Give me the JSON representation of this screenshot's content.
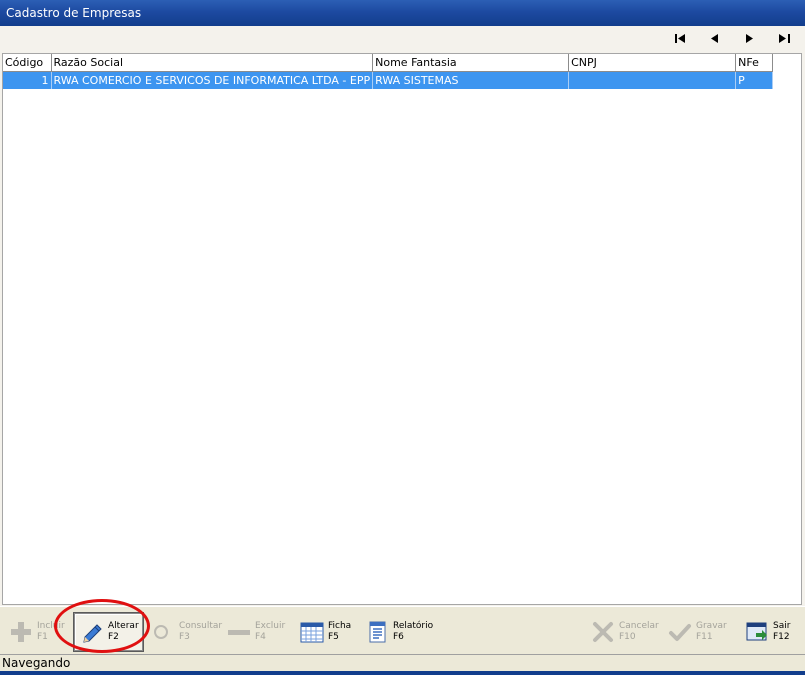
{
  "window": {
    "title": "Cadastro de Empresas"
  },
  "navigation": {
    "first_icon": "skip-first-icon",
    "prev_icon": "triangle-left-icon",
    "next_icon": "triangle-right-icon",
    "last_icon": "skip-last-icon"
  },
  "grid": {
    "columns": [
      "Código",
      "Razão Social",
      "Nome Fantasia",
      "CNPJ",
      "NFe"
    ],
    "rows": [
      {
        "codigo": "1",
        "razao_social": "RWA COMERCIO E SERVICOS DE INFORMATICA LTDA - EPP",
        "nome_fantasia": "RWA SISTEMAS",
        "cnpj": "",
        "nfe": "P"
      }
    ],
    "selected_row_color": "#3d95f0"
  },
  "toolbar": {
    "incluir": {
      "label": "Incluir",
      "key": "F1",
      "icon": "plus-icon",
      "enabled": false
    },
    "alterar": {
      "label": "Alterar",
      "key": "F2",
      "icon": "pencil-icon",
      "enabled": true
    },
    "consultar": {
      "label": "Consultar",
      "key": "F3",
      "icon": "magnifier-icon",
      "enabled": false
    },
    "excluir": {
      "label": "Excluir",
      "key": "F4",
      "icon": "minus-icon",
      "enabled": false
    },
    "ficha": {
      "label": "Ficha",
      "key": "F5",
      "icon": "calendar-icon",
      "enabled": true
    },
    "relatorio": {
      "label": "Relatório",
      "key": "F6",
      "icon": "report-icon",
      "enabled": true
    },
    "cancelar": {
      "label": "Cancelar",
      "key": "F10",
      "icon": "x-icon",
      "enabled": false
    },
    "gravar": {
      "label": "Gravar",
      "key": "F11",
      "icon": "check-icon",
      "enabled": false
    },
    "sair": {
      "label": "Sair",
      "key": "F12",
      "icon": "exit-window-icon",
      "enabled": true
    }
  },
  "status": {
    "text": "Navegando"
  },
  "annotation": {
    "color": "#e01010"
  }
}
